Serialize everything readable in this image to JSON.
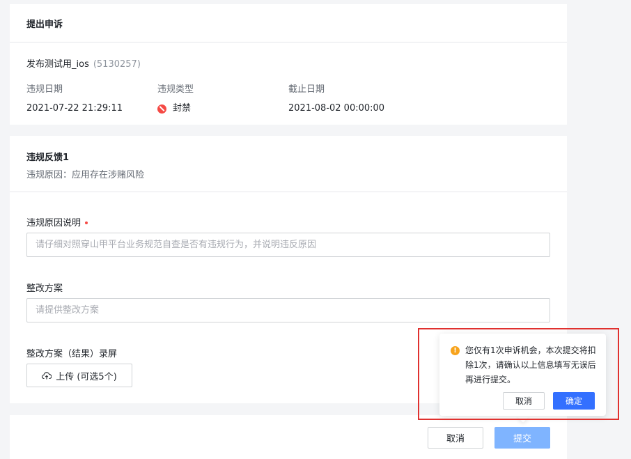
{
  "header": {
    "title": "提出申诉"
  },
  "app": {
    "name": "发布测试用_ios",
    "id": "(5130257)"
  },
  "violation": {
    "date_label": "违规日期",
    "date_value": "2021-07-22 21:29:11",
    "type_label": "违规类型",
    "type_value": "封禁",
    "deadline_label": "截止日期",
    "deadline_value": "2021-08-02 00:00:00"
  },
  "feedback": {
    "title": "违规反馈1",
    "reason": "违规原因：应用存在涉赌风险"
  },
  "form": {
    "explain_label": "违规原因说明",
    "explain_placeholder": "请仔细对照穿山甲平台业务规范自查是否有违规行为，并说明违反原因",
    "plan_label": "整改方案",
    "plan_placeholder": "请提供整改方案",
    "record_label": "整改方案（结果）录屏",
    "upload_label": "上传 (可选5个)"
  },
  "actions": {
    "cancel_label": "取消",
    "submit_label": "提交"
  },
  "popconfirm": {
    "message": "您仅有1次申诉机会，本次提交将扣除1次，请确认以上信息填写无误后再进行提交。",
    "cancel_label": "取消",
    "ok_label": "确定"
  },
  "colors": {
    "primary": "#3370ff",
    "submit_disabled": "#7fb4ff",
    "danger": "#f54a45",
    "warning": "#f7a31c",
    "highlight": "#e0312f"
  }
}
